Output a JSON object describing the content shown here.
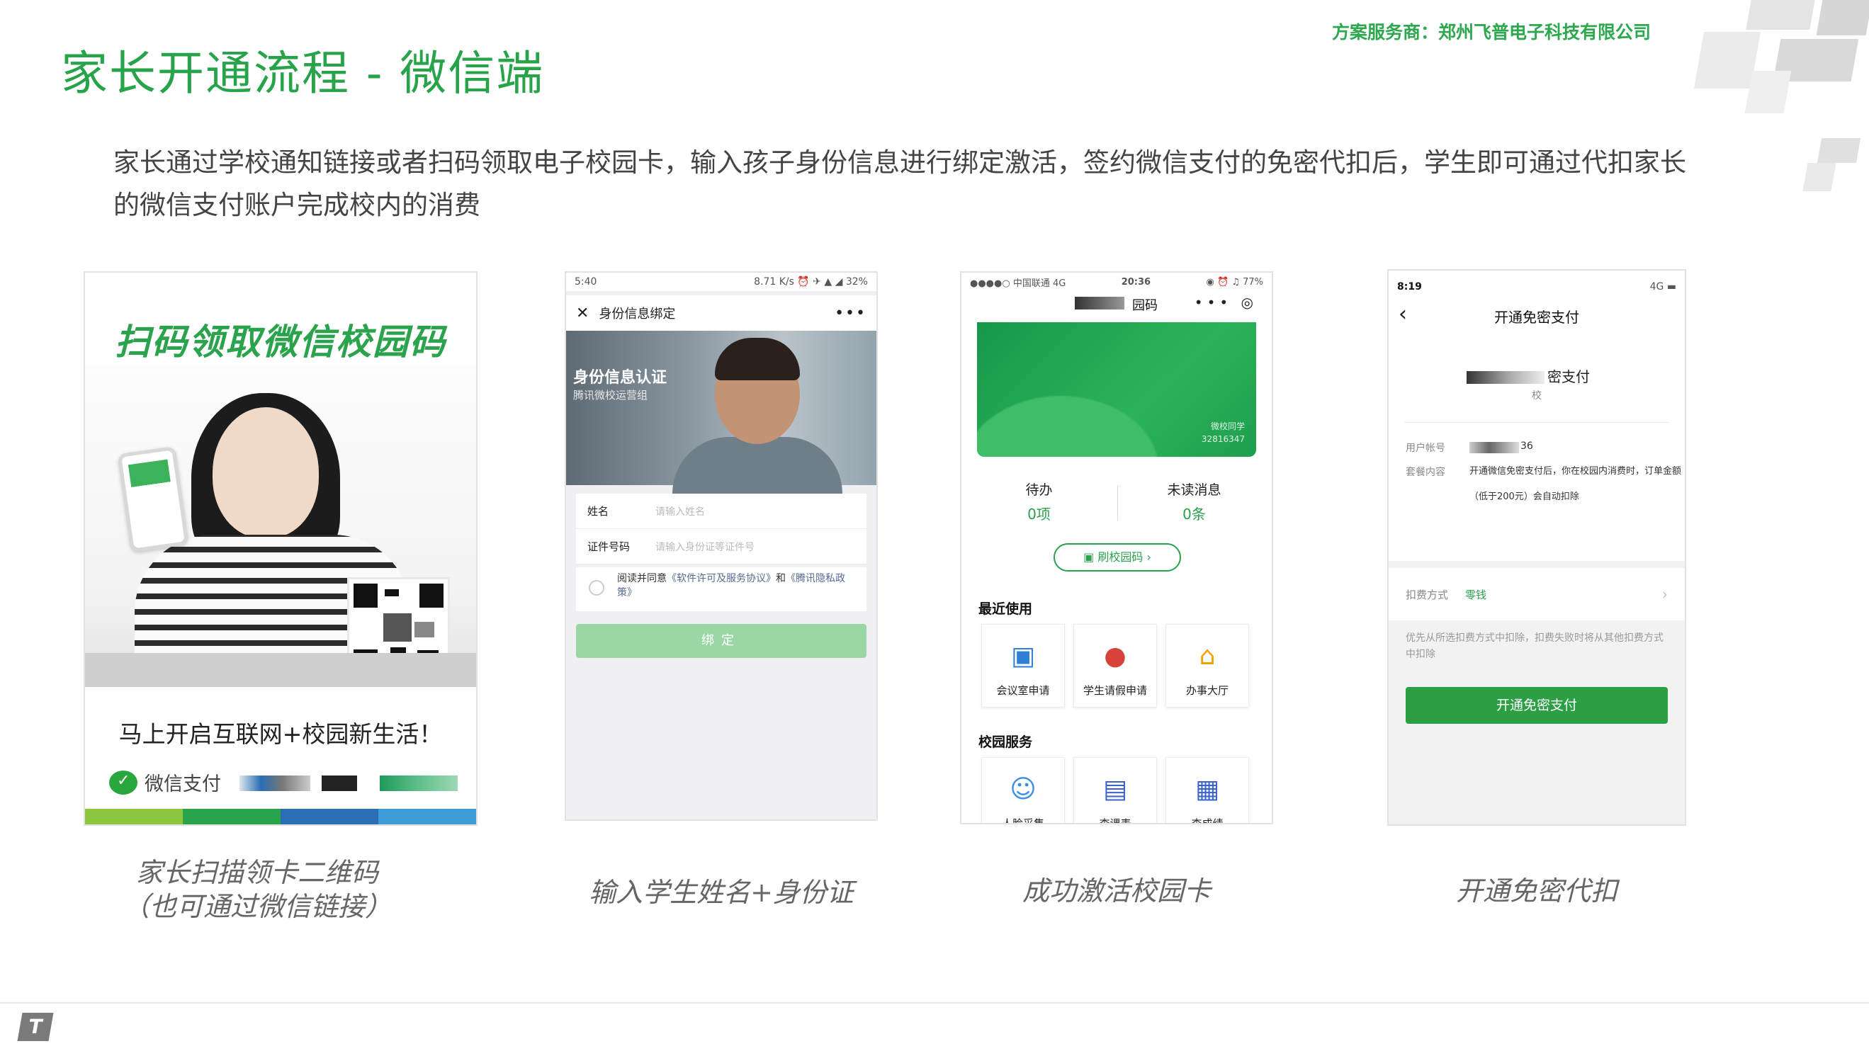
{
  "header": {
    "title": "家长开通流程 - 微信端",
    "provider": "方案服务商：郑州飞普电子科技有限公司",
    "intro": "家长通过学校通知链接或者扫码领取电子校园卡，输入孩子身份信息进行绑定激活，签约微信支付的免密代扣后，学生即可通过代扣家长的微信支付账户完成校内的消费"
  },
  "panel1": {
    "headline": "扫码领取微信校园码",
    "slogan": "马上开启互联网+校园新生活！",
    "pay_label": "微信支付",
    "caption_line1": "家长扫描领卡二维码",
    "caption_line2": "（也可通过微信链接）",
    "bar_colors": [
      "#8cc63f",
      "#2aa34a",
      "#2a6eb5",
      "#3d9bd8"
    ]
  },
  "panel2": {
    "status_time": "5:40",
    "status_right": "8.71 K/s ⏰ ✈ ▲ ◢ 32%",
    "nav_title": "身份信息绑定",
    "hero_title": "身份信息认证",
    "hero_sub": "腾讯微校运营组",
    "name_label": "姓名",
    "name_placeholder": "请输入姓名",
    "id_label": "证件号码",
    "id_placeholder": "请输入身份证等证件号",
    "agree_prefix": "阅读并同意",
    "agree_link1": "《软件许可及服务协议》",
    "agree_and": "和",
    "agree_link2": "《腾讯隐私政策》",
    "bind_button": "绑定",
    "caption": "输入学生姓名+身份证"
  },
  "panel3": {
    "status_left": "●●●●○ 中国联通 4G",
    "status_time": "20:36",
    "status_right": "◉ ⏰ ♫ 77%",
    "title": "园码",
    "card_line1": "微校同学",
    "card_line2": "32816347",
    "todo_label": "待办",
    "todo_value": "0项",
    "unread_label": "未读消息",
    "unread_value": "0条",
    "scan_button": "刷校园码",
    "recent_title": "最近使用",
    "recent_items": [
      {
        "label": "会议室申请",
        "icon": "▣"
      },
      {
        "label": "学生请假申请",
        "icon": "●"
      },
      {
        "label": "办事大厅",
        "icon": "⌂"
      }
    ],
    "campus_title": "校园服务",
    "campus_items": [
      {
        "label": "人脸采集",
        "icon": "☺"
      },
      {
        "label": "查课表",
        "icon": "▤"
      },
      {
        "label": "查成绩",
        "icon": "▦"
      }
    ],
    "caption": "成功激活校园卡"
  },
  "panel4": {
    "status_time": "8:19",
    "status_right": "4G ▬",
    "nav_title": "开通免密支付",
    "merchant": "密支付",
    "merchant_sub": "校",
    "account_label": "用户帐号",
    "account_value": "36",
    "package_label": "套餐内容",
    "package_value": "开通微信免密支付后，你在校园内消费时，订单金额（低于200元）会自动扣除",
    "method_label": "扣费方式",
    "method_value": "零钱",
    "note": "优先从所选扣费方式中扣除，扣费失败时将从其他扣费方式中扣除",
    "button": "开通免密支付",
    "caption": "开通免密代扣"
  },
  "footer": {
    "logo": "T"
  }
}
